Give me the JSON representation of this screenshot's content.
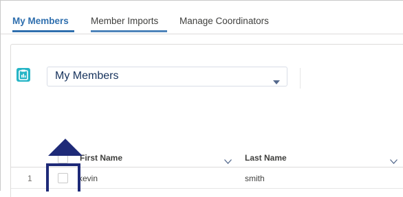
{
  "tabs": [
    {
      "label": "My Members",
      "active": true
    },
    {
      "label": "Member Imports",
      "active": false
    },
    {
      "label": "Manage Coordinators",
      "active": false
    }
  ],
  "list_view": {
    "selected": "My Members",
    "icon": "list-view-icon"
  },
  "table": {
    "columns": [
      {
        "label": "First Name"
      },
      {
        "label": "Last Name"
      }
    ],
    "rows": [
      {
        "number": "1",
        "first_name": "kevin",
        "last_name": "smith"
      }
    ]
  },
  "colors": {
    "accent": "#2f6fae",
    "icon_bg": "#26b5c6",
    "callout": "#1e2a78"
  }
}
